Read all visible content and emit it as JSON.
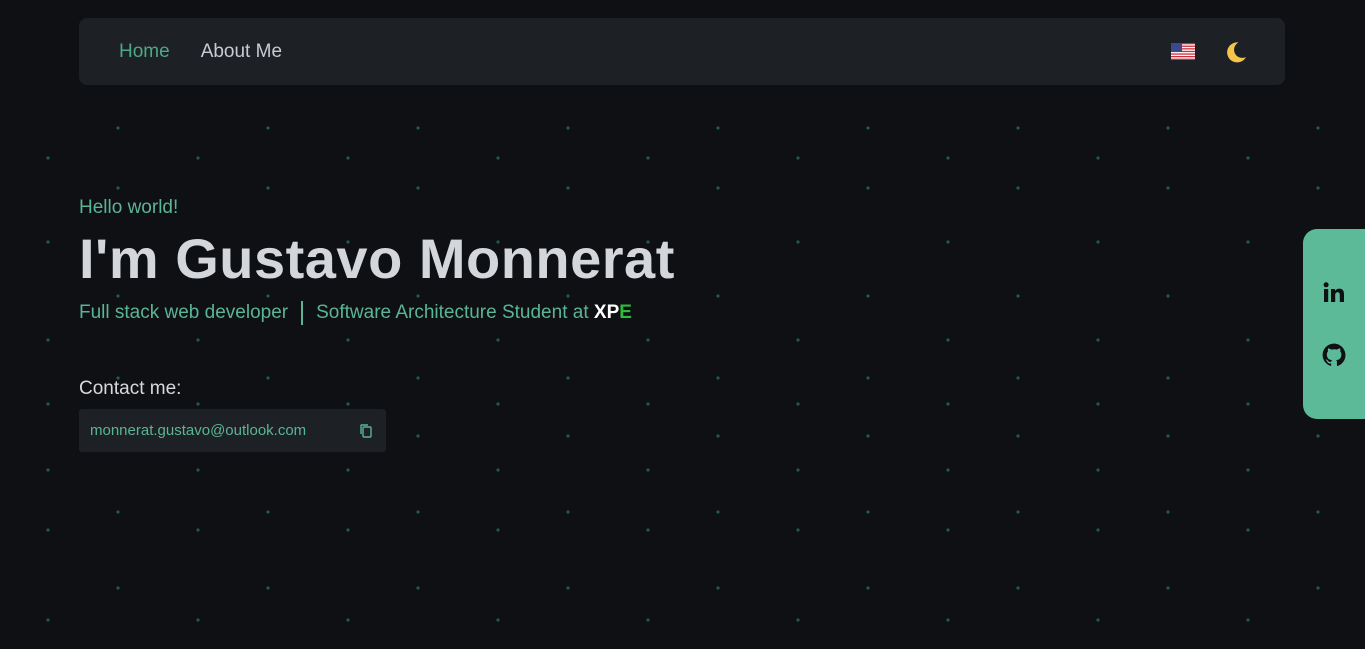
{
  "colors": {
    "background": "#0f1013",
    "surface": "#1d2024",
    "accent": "#5ab594",
    "social_panel": "#5cba98",
    "xpe_green": "#2dbb3e"
  },
  "nav": {
    "links": [
      {
        "label": "Home",
        "active": true
      },
      {
        "label": "About Me",
        "active": false
      }
    ],
    "language_icon": "us-flag-icon",
    "theme_icon": "moon-icon"
  },
  "hero": {
    "greeting": "Hello world!",
    "title": "I'm Gustavo Monnerat",
    "role": "Full stack web developer",
    "study": "Software Architecture Student at",
    "school_xp": "XP",
    "school_e": "E"
  },
  "contact": {
    "label": "Contact me:",
    "email": "monnerat.gustavo@outlook.com",
    "copy_icon": "copy-icon"
  },
  "social": {
    "icons": [
      "linkedin-icon",
      "github-icon"
    ]
  }
}
